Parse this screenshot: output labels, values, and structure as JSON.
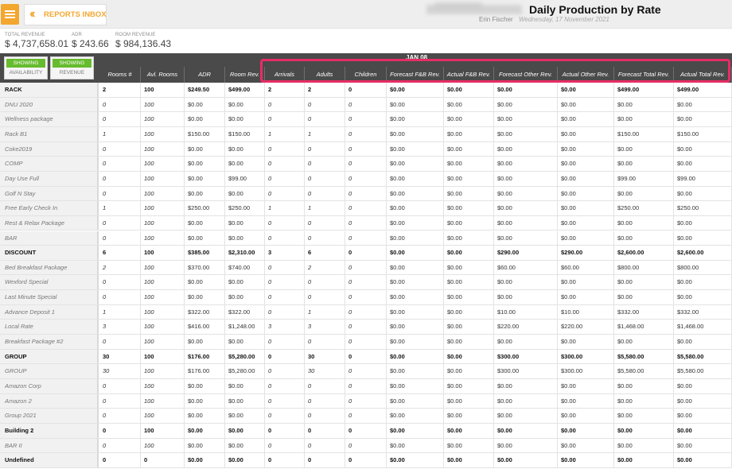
{
  "header": {
    "menu_icon": "hamburger-icon",
    "inbox_label": "REPORTS INBOX",
    "user_name": "Erin Fischer",
    "report_date": "Wednesday, 17 November 2021",
    "report_title": "Daily Production by Rate"
  },
  "stats": [
    {
      "label": "TOTAL REVENUE",
      "value": "$ 4,737,658.01"
    },
    {
      "label": "ADR",
      "value": "$ 243.66"
    },
    {
      "label": "ROOM REVENUE",
      "value": "$ 984,136.43"
    }
  ],
  "toggles": [
    {
      "tag": "SHOWING",
      "label": "AVAILABILITY"
    },
    {
      "tag": "SHOWING",
      "label": "REVENUE"
    }
  ],
  "date_label": "JAN 08",
  "colors": {
    "accent": "#f3a72f",
    "showing": "#66bb2e",
    "highlight": "#e82d66",
    "header": "#4a4a4a"
  },
  "columns": [
    "Rooms #",
    "Avl. Rooms",
    "ADR",
    "Room Rev.",
    "Arrivals",
    "Adults",
    "Children",
    "Forecast F&B Rev.",
    "Actual F&B Rev.",
    "Forecast Other Rev.",
    "Actual Other Rev.",
    "Forecast Total Rev.",
    "Actual Total Rev."
  ],
  "rows": [
    {
      "name": "RACK",
      "group": true,
      "cells": [
        "2",
        "100",
        "$249.50",
        "$499.00",
        "2",
        "2",
        "0",
        "$0.00",
        "$0.00",
        "$0.00",
        "$0.00",
        "$499.00",
        "$499.00"
      ]
    },
    {
      "name": "DNU 2020",
      "group": false,
      "cells": [
        "0",
        "100",
        "$0.00",
        "$0.00",
        "0",
        "0",
        "0",
        "$0.00",
        "$0.00",
        "$0.00",
        "$0.00",
        "$0.00",
        "$0.00"
      ]
    },
    {
      "name": "Wellness package",
      "group": false,
      "cells": [
        "0",
        "100",
        "$0.00",
        "$0.00",
        "0",
        "0",
        "0",
        "$0.00",
        "$0.00",
        "$0.00",
        "$0.00",
        "$0.00",
        "$0.00"
      ]
    },
    {
      "name": "Rack B1",
      "group": false,
      "cells": [
        "1",
        "100",
        "$150.00",
        "$150.00",
        "1",
        "1",
        "0",
        "$0.00",
        "$0.00",
        "$0.00",
        "$0.00",
        "$150.00",
        "$150.00"
      ]
    },
    {
      "name": "Coke2019",
      "group": false,
      "cells": [
        "0",
        "100",
        "$0.00",
        "$0.00",
        "0",
        "0",
        "0",
        "$0.00",
        "$0.00",
        "$0.00",
        "$0.00",
        "$0.00",
        "$0.00"
      ]
    },
    {
      "name": "COMP",
      "group": false,
      "cells": [
        "0",
        "100",
        "$0.00",
        "$0.00",
        "0",
        "0",
        "0",
        "$0.00",
        "$0.00",
        "$0.00",
        "$0.00",
        "$0.00",
        "$0.00"
      ]
    },
    {
      "name": "Day Use Full",
      "group": false,
      "cells": [
        "0",
        "100",
        "$0.00",
        "$99.00",
        "0",
        "0",
        "0",
        "$0.00",
        "$0.00",
        "$0.00",
        "$0.00",
        "$99.00",
        "$99.00"
      ]
    },
    {
      "name": "Golf N Stay",
      "group": false,
      "cells": [
        "0",
        "100",
        "$0.00",
        "$0.00",
        "0",
        "0",
        "0",
        "$0.00",
        "$0.00",
        "$0.00",
        "$0.00",
        "$0.00",
        "$0.00"
      ]
    },
    {
      "name": "Free Early Check In",
      "group": false,
      "cells": [
        "1",
        "100",
        "$250.00",
        "$250.00",
        "1",
        "1",
        "0",
        "$0.00",
        "$0.00",
        "$0.00",
        "$0.00",
        "$250.00",
        "$250.00"
      ]
    },
    {
      "name": "Rest & Relax Package",
      "group": false,
      "cells": [
        "0",
        "100",
        "$0.00",
        "$0.00",
        "0",
        "0",
        "0",
        "$0.00",
        "$0.00",
        "$0.00",
        "$0.00",
        "$0.00",
        "$0.00"
      ]
    },
    {
      "name": "BAR",
      "group": false,
      "cells": [
        "0",
        "100",
        "$0.00",
        "$0.00",
        "0",
        "0",
        "0",
        "$0.00",
        "$0.00",
        "$0.00",
        "$0.00",
        "$0.00",
        "$0.00"
      ]
    },
    {
      "name": "DISCOUNT",
      "group": true,
      "cells": [
        "6",
        "100",
        "$385.00",
        "$2,310.00",
        "3",
        "6",
        "0",
        "$0.00",
        "$0.00",
        "$290.00",
        "$290.00",
        "$2,600.00",
        "$2,600.00"
      ]
    },
    {
      "name": "Bed Breakfast Package",
      "group": false,
      "cells": [
        "2",
        "100",
        "$370.00",
        "$740.00",
        "0",
        "2",
        "0",
        "$0.00",
        "$0.00",
        "$60.00",
        "$60.00",
        "$800.00",
        "$800.00"
      ]
    },
    {
      "name": "Wexford Special",
      "group": false,
      "cells": [
        "0",
        "100",
        "$0.00",
        "$0.00",
        "0",
        "0",
        "0",
        "$0.00",
        "$0.00",
        "$0.00",
        "$0.00",
        "$0.00",
        "$0.00"
      ]
    },
    {
      "name": "Last Minute Special",
      "group": false,
      "cells": [
        "0",
        "100",
        "$0.00",
        "$0.00",
        "0",
        "0",
        "0",
        "$0.00",
        "$0.00",
        "$0.00",
        "$0.00",
        "$0.00",
        "$0.00"
      ]
    },
    {
      "name": "Advance Deposit 1",
      "group": false,
      "cells": [
        "1",
        "100",
        "$322.00",
        "$322.00",
        "0",
        "1",
        "0",
        "$0.00",
        "$0.00",
        "$10.00",
        "$10.00",
        "$332.00",
        "$332.00"
      ]
    },
    {
      "name": "Local Rate",
      "group": false,
      "cells": [
        "3",
        "100",
        "$416.00",
        "$1,248.00",
        "3",
        "3",
        "0",
        "$0.00",
        "$0.00",
        "$220.00",
        "$220.00",
        "$1,468.00",
        "$1,468.00"
      ]
    },
    {
      "name": "Breakfast Package #2",
      "group": false,
      "cells": [
        "0",
        "100",
        "$0.00",
        "$0.00",
        "0",
        "0",
        "0",
        "$0.00",
        "$0.00",
        "$0.00",
        "$0.00",
        "$0.00",
        "$0.00"
      ]
    },
    {
      "name": "GROUP",
      "group": true,
      "cells": [
        "30",
        "100",
        "$176.00",
        "$5,280.00",
        "0",
        "30",
        "0",
        "$0.00",
        "$0.00",
        "$300.00",
        "$300.00",
        "$5,580.00",
        "$5,580.00"
      ]
    },
    {
      "name": "GROUP",
      "group": false,
      "cells": [
        "30",
        "100",
        "$176.00",
        "$5,280.00",
        "0",
        "30",
        "0",
        "$0.00",
        "$0.00",
        "$300.00",
        "$300.00",
        "$5,580.00",
        "$5,580.00"
      ]
    },
    {
      "name": "Amazon Corp",
      "group": false,
      "cells": [
        "0",
        "100",
        "$0.00",
        "$0.00",
        "0",
        "0",
        "0",
        "$0.00",
        "$0.00",
        "$0.00",
        "$0.00",
        "$0.00",
        "$0.00"
      ]
    },
    {
      "name": "Amazon 2",
      "group": false,
      "cells": [
        "0",
        "100",
        "$0.00",
        "$0.00",
        "0",
        "0",
        "0",
        "$0.00",
        "$0.00",
        "$0.00",
        "$0.00",
        "$0.00",
        "$0.00"
      ]
    },
    {
      "name": "Group 2021",
      "group": false,
      "cells": [
        "0",
        "100",
        "$0.00",
        "$0.00",
        "0",
        "0",
        "0",
        "$0.00",
        "$0.00",
        "$0.00",
        "$0.00",
        "$0.00",
        "$0.00"
      ]
    },
    {
      "name": "Building 2",
      "group": true,
      "cells": [
        "0",
        "100",
        "$0.00",
        "$0.00",
        "0",
        "0",
        "0",
        "$0.00",
        "$0.00",
        "$0.00",
        "$0.00",
        "$0.00",
        "$0.00"
      ]
    },
    {
      "name": "BAR II",
      "group": false,
      "cells": [
        "0",
        "100",
        "$0.00",
        "$0.00",
        "0",
        "0",
        "0",
        "$0.00",
        "$0.00",
        "$0.00",
        "$0.00",
        "$0.00",
        "$0.00"
      ]
    },
    {
      "name": "Undefined",
      "group": true,
      "cells": [
        "0",
        "0",
        "$0.00",
        "$0.00",
        "0",
        "0",
        "0",
        "$0.00",
        "$0.00",
        "$0.00",
        "$0.00",
        "$0.00",
        "$0.00"
      ]
    }
  ]
}
